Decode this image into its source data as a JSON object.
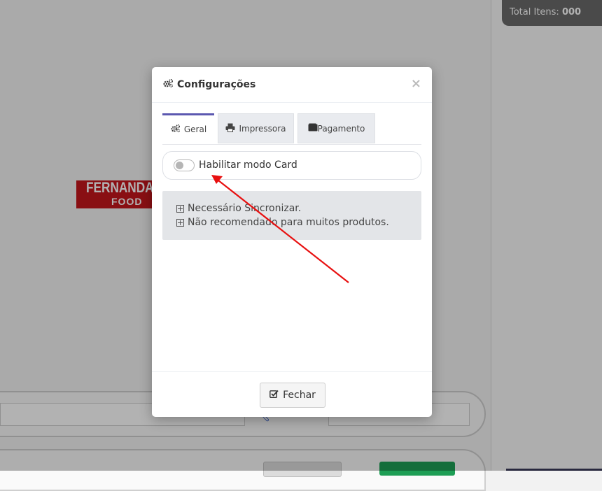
{
  "background": {
    "total_label": "Total Itens:",
    "total_value": "000",
    "logo_top": "FERNANDA",
    "logo_bottom": "FOOD"
  },
  "modal": {
    "title": "Configurações",
    "close_label": "×",
    "tabs": [
      {
        "label": "Geral",
        "icon": "gears-icon",
        "active": true
      },
      {
        "label": "Impressora",
        "icon": "printer-icon",
        "active": false
      },
      {
        "label": "Pagamento",
        "icon": "wallet-icon",
        "active": false
      }
    ],
    "toggle": {
      "label": "Habilitar modo Card",
      "checked": false
    },
    "info": [
      "Necessário Sincronizar.",
      "Não recomendado para muitos produtos."
    ],
    "close_button": "Fechar"
  },
  "colors": {
    "accent_tab": "#5c58b0",
    "annotation_arrow": "#e81010",
    "logo_red": "#c4161c"
  }
}
